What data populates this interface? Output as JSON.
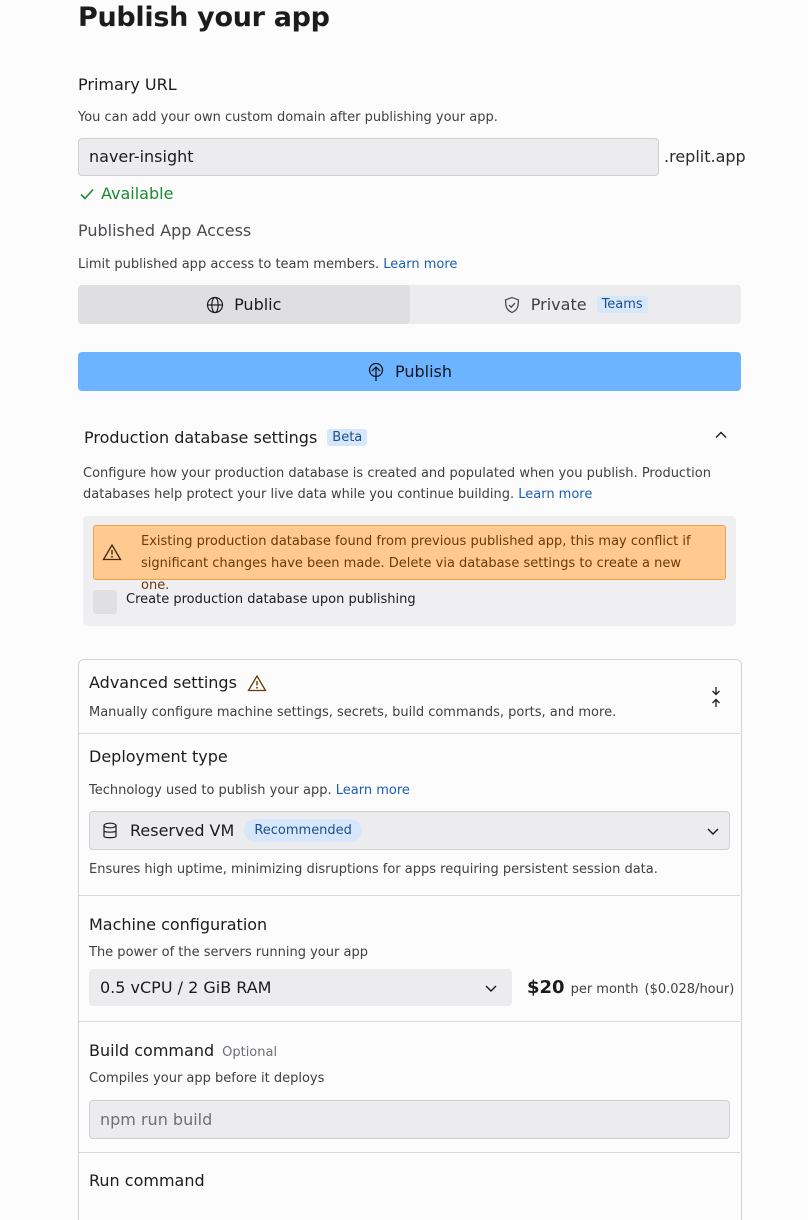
{
  "page": {
    "title": "Publish your app"
  },
  "primary_url": {
    "heading": "Primary URL",
    "description": "You can add your own custom domain after publishing your app.",
    "value": "naver-insight",
    "suffix": ".replit.app",
    "status": "Available"
  },
  "access": {
    "heading": "Published App Access",
    "description": "Limit published app access to team members.",
    "learn_more": "Learn more",
    "options": [
      {
        "label": "Public",
        "icon": "globe-icon",
        "selected": true
      },
      {
        "label": "Private",
        "icon": "shield-icon",
        "badge": "Teams",
        "selected": false
      }
    ]
  },
  "publish_button": {
    "label": "Publish",
    "icon": "publish-icon"
  },
  "production_db": {
    "heading": "Production database settings",
    "badge": "Beta",
    "description": "Configure how your production database is created and populated when you publish. Production databases help protect your live data while you continue building.",
    "learn_more": "Learn more",
    "warning": "Existing production database found from previous published app, this may conflict if significant changes have been made. Delete via database settings to create a new one.",
    "checkbox_label": "Create production database upon publishing",
    "checkbox_checked": false
  },
  "advanced": {
    "heading": "Advanced settings",
    "description": "Manually configure machine settings, secrets, build commands, ports, and more.",
    "deployment_type": {
      "heading": "Deployment type",
      "description": "Technology used to publish your app.",
      "learn_more": "Learn more",
      "selected": "Reserved VM",
      "badge": "Recommended",
      "note": "Ensures high uptime, minimizing disruptions for apps requiring persistent session data."
    },
    "machine": {
      "heading": "Machine configuration",
      "description": "The power of the servers running your app",
      "selected": "0.5 vCPU / 2 GiB RAM",
      "price": "$20",
      "price_period": "per month",
      "price_hourly": "($0.028/hour)"
    },
    "build": {
      "heading": "Build command",
      "optional": "Optional",
      "description": "Compiles your app before it deploys",
      "placeholder": "npm run build"
    },
    "run": {
      "heading": "Run command"
    }
  },
  "colors": {
    "accent": "#6cb4ff",
    "success": "#1a8a32",
    "warning_bg": "#ffc98f",
    "link": "#1a5fb4"
  }
}
